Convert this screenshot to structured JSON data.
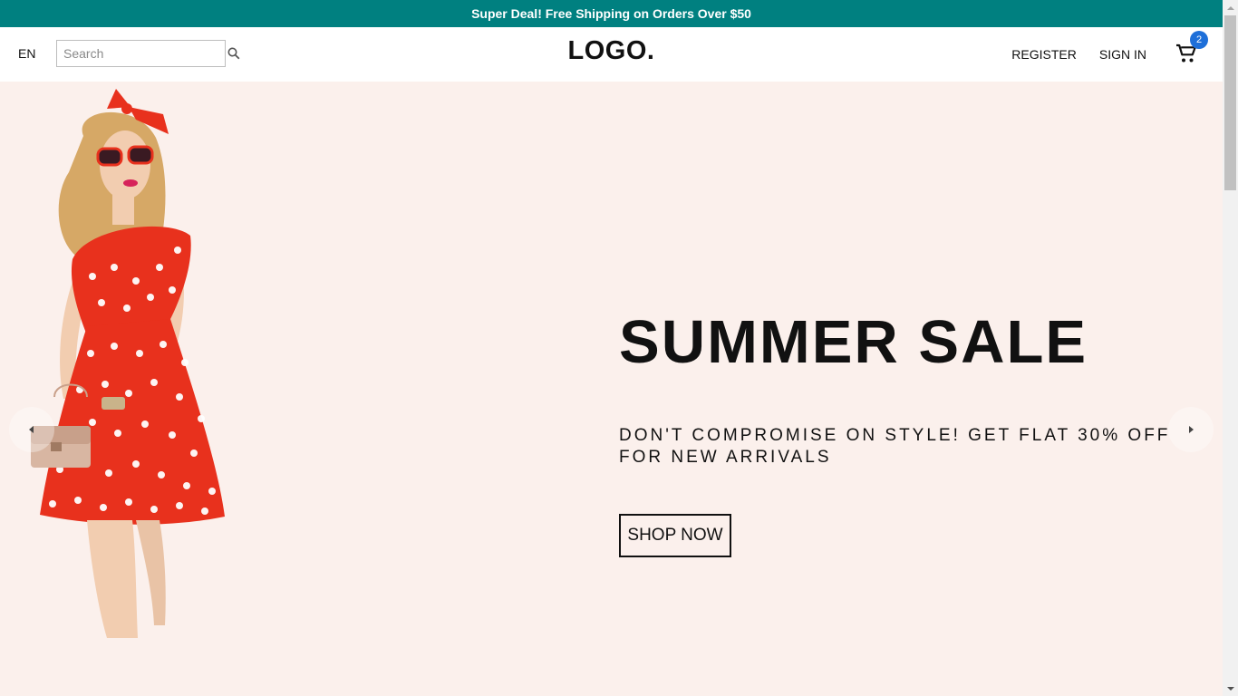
{
  "announcement": {
    "text": "Super Deal! Free Shipping on Orders Over $50"
  },
  "navbar": {
    "language": "EN",
    "search": {
      "placeholder": "Search",
      "value": ""
    },
    "logo": "LOGO.",
    "links": {
      "register": "REGISTER",
      "sign_in": "SIGN IN"
    },
    "cart": {
      "count": "2",
      "icon": "cart-icon"
    }
  },
  "hero": {
    "headline": "SUMMER SALE",
    "subheadline": "DON'T COMPROMISE ON STYLE! GET FLAT 30% OFF FOR NEW ARRIVALS",
    "cta_label": "SHOP NOW",
    "image": "model-red-polka-dot-dress"
  },
  "colors": {
    "announcement_bg": "#008080",
    "hero_bg": "#fbf0ec",
    "badge_bg": "#1e6fd9",
    "dress_red": "#e8311d"
  }
}
